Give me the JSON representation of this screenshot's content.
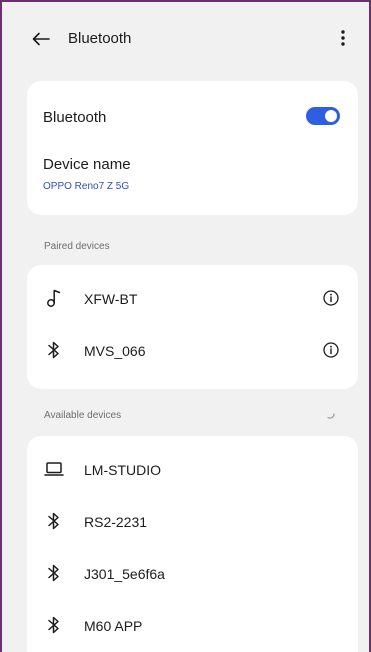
{
  "appbar": {
    "title": "Bluetooth",
    "back_icon": "arrow-left-icon",
    "more_icon": "more-vertical-icon"
  },
  "bluetooth_card": {
    "toggle_label": "Bluetooth",
    "toggle_on": true,
    "device_name_label": "Device name",
    "device_name_value": "OPPO Reno7 Z 5G"
  },
  "paired": {
    "header": "Paired devices",
    "devices": [
      {
        "name": "XFW-BT",
        "icon": "music-note-icon"
      },
      {
        "name": "MVS_066",
        "icon": "bluetooth-icon"
      }
    ]
  },
  "available": {
    "header": "Available devices",
    "devices": [
      {
        "name": "LM-STUDIO",
        "icon": "laptop-icon"
      },
      {
        "name": "RS2-2231",
        "icon": "bluetooth-icon"
      },
      {
        "name": "J301_5e6f6a",
        "icon": "bluetooth-icon"
      },
      {
        "name": "M60 APP",
        "icon": "bluetooth-icon"
      }
    ]
  },
  "colors": {
    "accent": "#2f5fe0",
    "device_name_value": "#2f4fc0",
    "background": "#f1f1f1",
    "card": "#ffffff"
  }
}
